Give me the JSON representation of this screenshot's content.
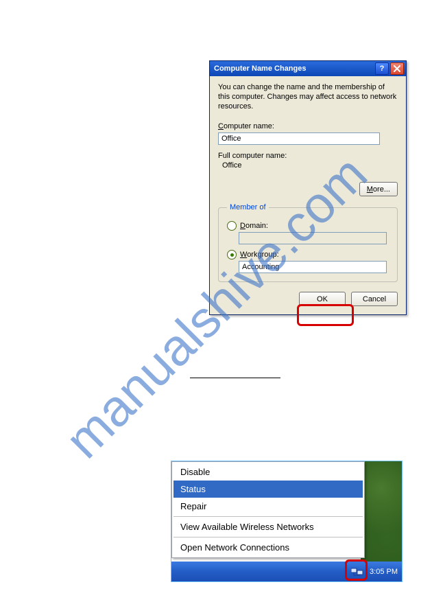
{
  "watermark": "manualshive.com",
  "dialog": {
    "title": "Computer Name Changes",
    "description": "You can change the name and the membership of this computer. Changes may affect access to network resources.",
    "computer_name_label": "Computer name:",
    "computer_name_value": "Office",
    "full_name_label": "Full computer name:",
    "full_name_value": "Office",
    "more_label": "More...",
    "member_of_legend": "Member of",
    "domain_label": "Domain:",
    "domain_value": "",
    "workgroup_label": "Workgroup:",
    "workgroup_value": "Accounting",
    "ok_label": "OK",
    "cancel_label": "Cancel"
  },
  "tray": {
    "clock": "3:05 PM",
    "menu": {
      "items": [
        "Disable",
        "Status",
        "Repair",
        "View Available Wireless Networks",
        "Open Network Connections"
      ],
      "selected_index": 1
    }
  }
}
